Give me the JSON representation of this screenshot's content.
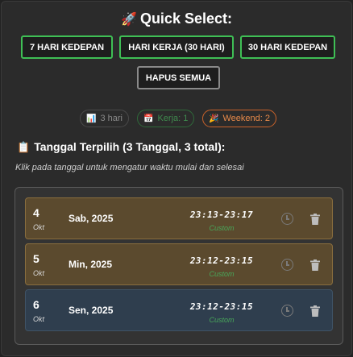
{
  "header": {
    "title": "Quick Select:",
    "icon": "rocket-icon"
  },
  "quick_buttons": [
    {
      "label": "7 HARI KEDEPAN"
    },
    {
      "label": "HARI KERJA (30 HARI)"
    },
    {
      "label": "30 HARI KEDEPAN"
    },
    {
      "label": "HAPUS SEMUA"
    }
  ],
  "summary_chips": {
    "days": "3 hari",
    "work": "Kerja: 1",
    "weekend": "Weekend: 2"
  },
  "selected": {
    "title": "Tanggal Terpilih (3 Tanggal, 3 total):",
    "hint": "Klik pada tanggal untuk mengatur waktu mulai dan selesai",
    "items": [
      {
        "day": "4",
        "month": "Okt",
        "date": "Sab, 2025",
        "time": "23:13-23:17",
        "tag": "Custom",
        "kind": "weekend"
      },
      {
        "day": "5",
        "month": "Okt",
        "date": "Min, 2025",
        "time": "23:12-23:15",
        "tag": "Custom",
        "kind": "weekend"
      },
      {
        "day": "6",
        "month": "Okt",
        "date": "Sen, 2025",
        "time": "23:12-23:15",
        "tag": "Custom",
        "kind": "weekday"
      }
    ]
  },
  "colors": {
    "accent_green": "#3fbf55",
    "weekend_orange": "#e88a4a",
    "weekend_row": "#5b4a2e",
    "weekday_row": "#2f3e4e"
  }
}
